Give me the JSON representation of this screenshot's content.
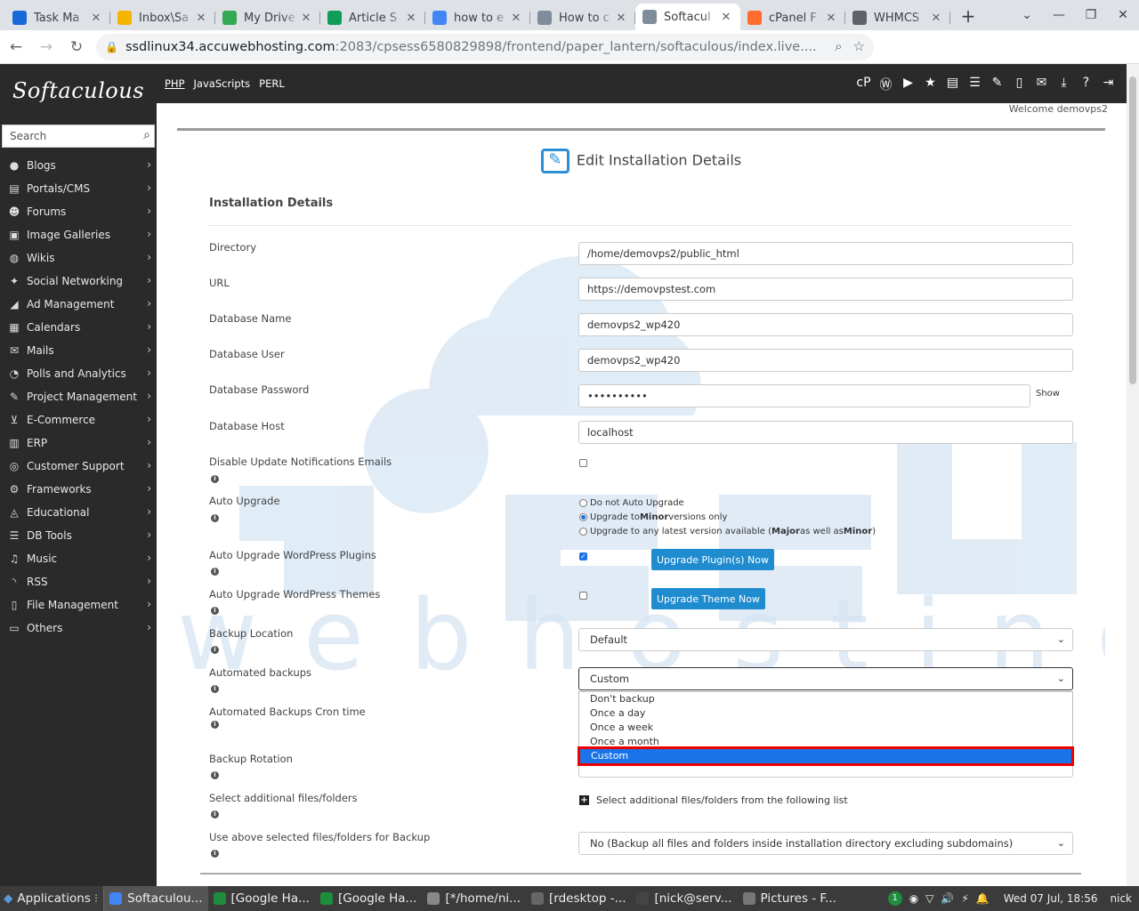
{
  "browser": {
    "tabs": [
      {
        "title": "Task Ma",
        "icon": "trello-icon",
        "color": "#1868db"
      },
      {
        "title": "Inbox\\Sa",
        "icon": "mail-icon",
        "color": "#f4b400"
      },
      {
        "title": "My Drive",
        "icon": "drive-icon",
        "color": "#34a853"
      },
      {
        "title": "Article S",
        "icon": "sheets-icon",
        "color": "#0f9d58"
      },
      {
        "title": "how to e",
        "icon": "google-icon",
        "color": "#4285f4"
      },
      {
        "title": "How to c",
        "icon": "softaculous-icon",
        "color": "#7f8c9b"
      },
      {
        "title": "Softacul",
        "icon": "softaculous-icon",
        "color": "#7f8c9b"
      },
      {
        "title": "cPanel F",
        "icon": "cpanel-icon",
        "color": "#ff6c2c"
      },
      {
        "title": "WHMCS",
        "icon": "globe-icon",
        "color": "#5f6368"
      }
    ],
    "url_host": "ssdlinux34.accuwebhosting.com",
    "url_path": ":2083/cpsess6580829898/frontend/paper_lantern/softaculous/index.live...."
  },
  "app": {
    "logo": "Softaculous",
    "search_placeholder": "Search",
    "langs": [
      "PHP",
      "JavaScripts",
      "PERL"
    ],
    "welcome": "Welcome demovps2",
    "categories": [
      {
        "label": "Blogs",
        "icon": "user-icon"
      },
      {
        "label": "Portals/CMS",
        "icon": "list-icon"
      },
      {
        "label": "Forums",
        "icon": "users-icon"
      },
      {
        "label": "Image Galleries",
        "icon": "image-icon"
      },
      {
        "label": "Wikis",
        "icon": "globe-icon"
      },
      {
        "label": "Social Networking",
        "icon": "comments-icon"
      },
      {
        "label": "Ad Management",
        "icon": "bullhorn-icon"
      },
      {
        "label": "Calendars",
        "icon": "calendar-icon"
      },
      {
        "label": "Mails",
        "icon": "envelope-icon"
      },
      {
        "label": "Polls and Analytics",
        "icon": "chart-pie-icon"
      },
      {
        "label": "Project Management",
        "icon": "edit-icon"
      },
      {
        "label": "E-Commerce",
        "icon": "cart-icon"
      },
      {
        "label": "ERP",
        "icon": "bar-chart-icon"
      },
      {
        "label": "Customer Support",
        "icon": "support-icon"
      },
      {
        "label": "Frameworks",
        "icon": "cogs-icon"
      },
      {
        "label": "Educational",
        "icon": "graduation-cap-icon"
      },
      {
        "label": "DB Tools",
        "icon": "database-icon"
      },
      {
        "label": "Music",
        "icon": "music-icon"
      },
      {
        "label": "RSS",
        "icon": "rss-icon"
      },
      {
        "label": "File Management",
        "icon": "file-icon"
      },
      {
        "label": "Others",
        "icon": "folder-icon"
      }
    ]
  },
  "form": {
    "page_title": "Edit Installation Details",
    "section": "Installation Details",
    "directory_label": "Directory",
    "directory": "/home/demovps2/public_html",
    "url_label": "URL",
    "url": "https://demovpstest.com",
    "dbname_label": "Database Name",
    "dbname": "demovps2_wp420",
    "dbuser_label": "Database User",
    "dbuser": "demovps2_wp420",
    "dbpass_label": "Database Password",
    "dbpass": "••••••••••",
    "show_label": "Show",
    "dbhost_label": "Database Host",
    "dbhost": "localhost",
    "disable_notif_label": "Disable Update Notifications Emails",
    "auto_upgrade_label": "Auto Upgrade",
    "au_opt1": "Do not Auto Upgrade",
    "au_opt2_pre": "Upgrade to ",
    "au_opt2_bold": "Minor",
    "au_opt2_post": " versions only",
    "au_opt3_pre": "Upgrade to any latest version available (",
    "au_opt3_b1": "Major",
    "au_opt3_mid": " as well as ",
    "au_opt3_b2": "Minor",
    "au_opt3_post": ")",
    "plugins_label": "Auto Upgrade WordPress Plugins",
    "plugins_btn": "Upgrade Plugin(s) Now",
    "themes_label": "Auto Upgrade WordPress Themes",
    "themes_btn": "Upgrade Theme Now",
    "backup_loc_label": "Backup Location",
    "backup_loc": "Default",
    "auto_backups_label": "Automated backups",
    "auto_backups": "Custom",
    "auto_backups_options": [
      "Don't backup",
      "Once a day",
      "Once a week",
      "Once a month",
      "Custom"
    ],
    "cron_label": "Automated Backups Cron time",
    "rotation_label": "Backup Rotation",
    "addl_label": "Select additional files/folders",
    "addl_text": "Select additional files/folders from the following list",
    "use_above_label": "Use above selected files/folders for Backup",
    "use_above": "No (Backup all files and folders inside installation directory excluding subdomains)"
  },
  "taskbar": {
    "apps_label": "Applications",
    "items": [
      "Softaculou...",
      "[Google Ha...",
      "[Google Ha...",
      "[*/home/ni...",
      "[rdesktop -...",
      "[nick@serv...",
      "Pictures - F..."
    ],
    "clock": "Wed 07 Jul, 18:56",
    "user": "nick"
  }
}
